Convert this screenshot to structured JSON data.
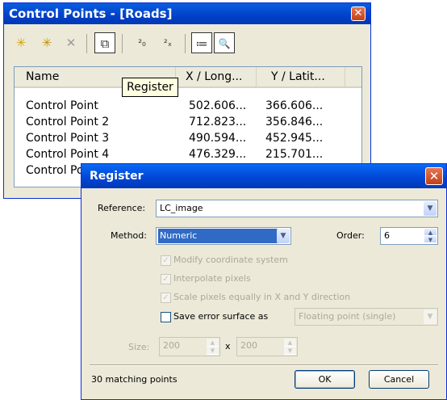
{
  "control_points_window": {
    "title": "Control Points - [Roads]",
    "close_glyph": "✕",
    "toolbar": {
      "icons": [
        "add-point-icon",
        "add-point-2-icon",
        "delete-icon",
        "window-icon",
        "link-icon",
        "unlink-icon",
        "list-icon",
        "preview-icon"
      ],
      "glyphs": {
        "add1": "✳",
        "add2": "✳",
        "del": "✕",
        "win": "⧉",
        "link": "²₀",
        "unlink": "²ₓ",
        "list": "≔",
        "prev": "🔍"
      }
    },
    "columns": [
      "Name",
      "X / Long...",
      "Y / Latit..."
    ],
    "rows": [
      {
        "name": "Control Point",
        "x": "502.606...",
        "y": "366.606..."
      },
      {
        "name": "Control Point 2",
        "x": "712.823...",
        "y": "356.846..."
      },
      {
        "name": "Control Point 3",
        "x": "490.594...",
        "y": "452.945..."
      },
      {
        "name": "Control Point 4",
        "x": "476.329...",
        "y": "215.701..."
      },
      {
        "name": "Control Po",
        "x": "",
        "y": ""
      }
    ],
    "tooltip": "Register"
  },
  "register_dialog": {
    "title": "Register",
    "close_glyph": "✕",
    "reference_label": "Reference:",
    "reference_value": "LC_image",
    "method_label": "Method:",
    "method_value": "Numeric",
    "order_label": "Order:",
    "order_value": "6",
    "modify_label": "Modify coordinate system",
    "interpolate_label": "Interpolate pixels",
    "scale_label": "Scale pixels equally in X and Y direction",
    "save_label": "Save error surface as",
    "save_type_value": "Floating point (single)",
    "size_label": "Size:",
    "size_w": "200",
    "size_x": "x",
    "size_h": "200",
    "status_text": "30 matching points",
    "ok_label": "OK",
    "cancel_label": "Cancel"
  }
}
